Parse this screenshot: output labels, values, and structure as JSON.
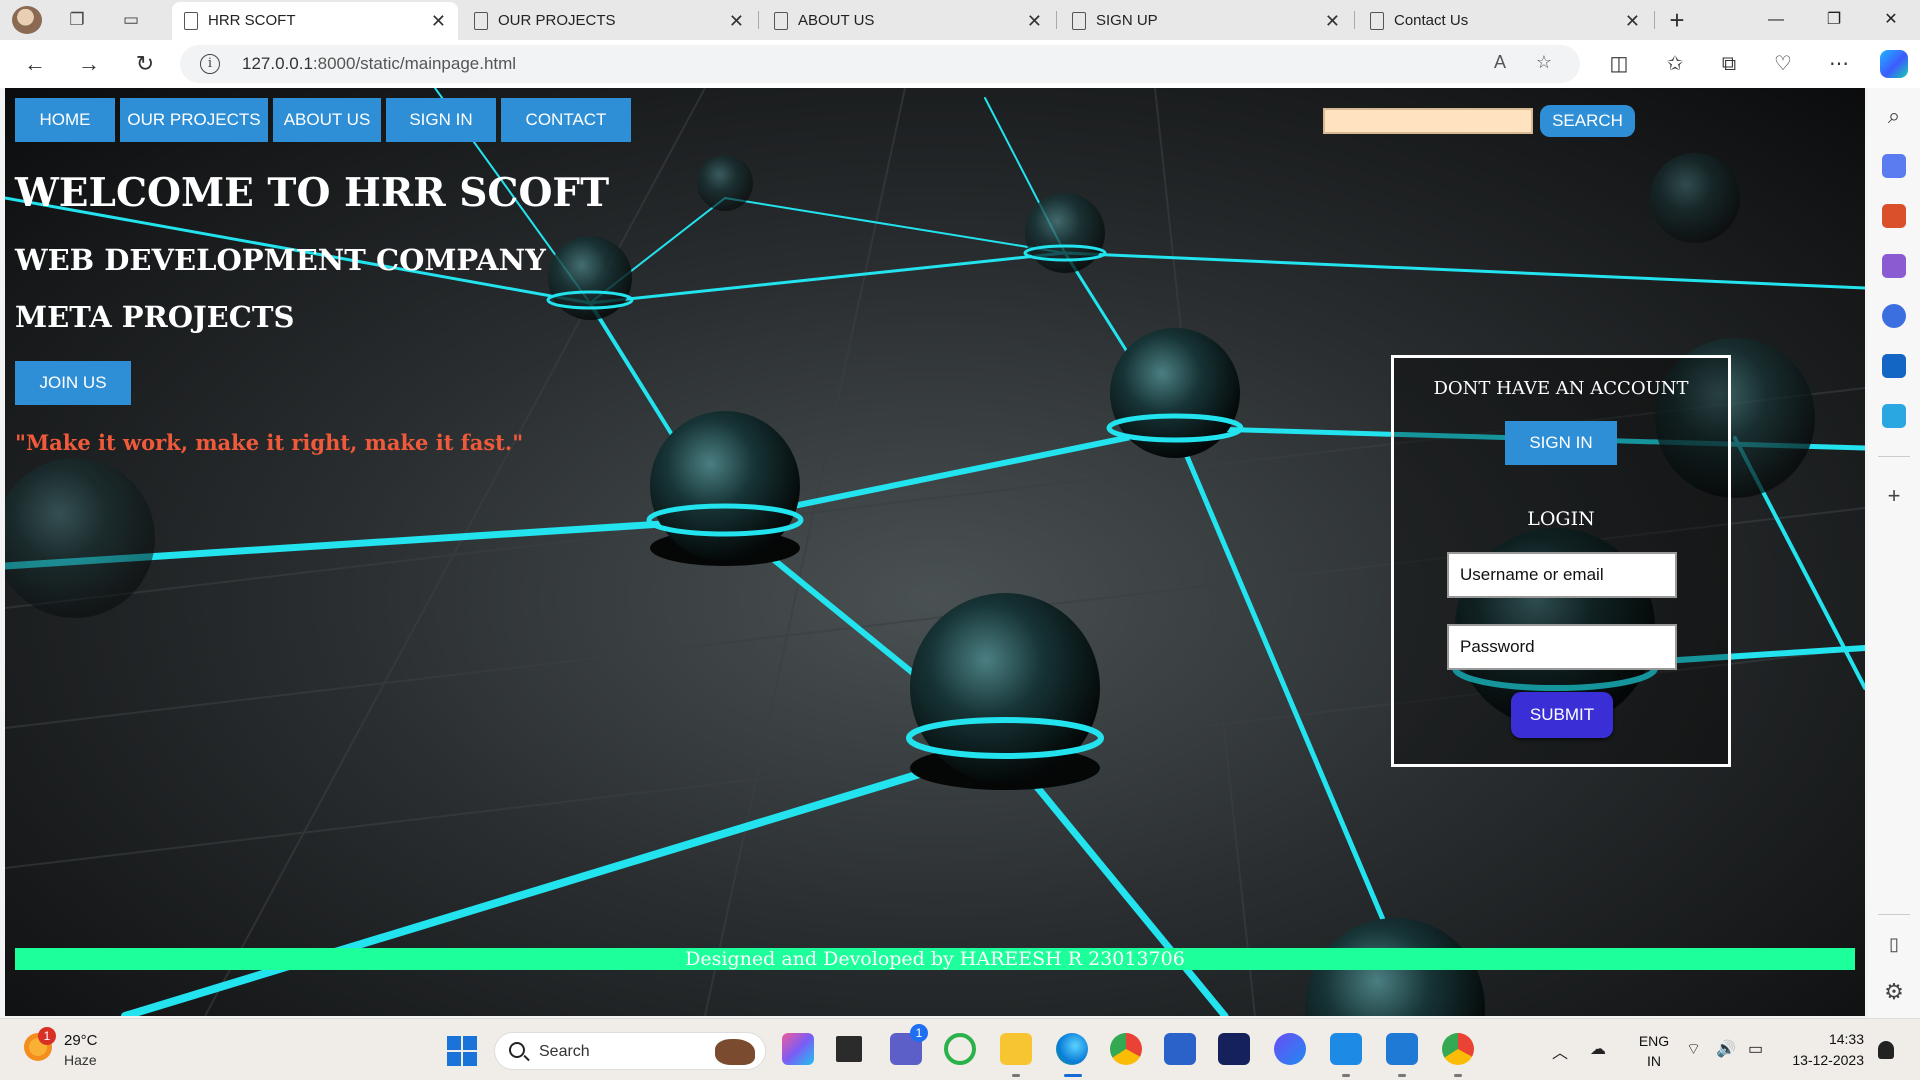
{
  "browser": {
    "tabs": [
      {
        "title": "HRR SCOFT",
        "active": true
      },
      {
        "title": "OUR PROJECTS",
        "active": false
      },
      {
        "title": "ABOUT US",
        "active": false
      },
      {
        "title": "SIGN UP",
        "active": false
      },
      {
        "title": "Contact Us",
        "active": false
      }
    ],
    "url_host": "127.0.0.1",
    "url_path": ":8000/static/mainpage.html",
    "icons": [
      "back-icon",
      "forward-icon",
      "refresh-icon",
      "info-icon",
      "read-aloud-icon",
      "favorite-star-icon",
      "split-screen-icon",
      "favorites-icon",
      "collections-icon",
      "browser-essentials-icon",
      "more-icon",
      "copilot-icon"
    ]
  },
  "page": {
    "nav": [
      "HOME",
      "OUR PROJECTS",
      "ABOUT US",
      "SIGN IN",
      "CONTACT"
    ],
    "search_value": "",
    "search_button": "SEARCH",
    "title": "WELCOME TO HRR SCOFT",
    "subtitle": "WEB DEVELOPMENT COMPANY",
    "subtitle2": "META PROJECTS",
    "join_button": "JOIN US",
    "quote": "\"Make it work, make it right, make it fast.\"",
    "panel": {
      "no_account": "DONT HAVE AN ACCOUNT",
      "signin_button": "SIGN IN",
      "login_heading": "LOGIN",
      "username_placeholder": "Username or email",
      "password_placeholder": "Password",
      "submit_button": "SUBMIT"
    },
    "footer": "Designed and Devoloped by HAREESH R 23013706",
    "colors": {
      "accent_blue": "#2f8fd6",
      "submit_blue": "#3a2fd6",
      "quote_red": "#f05a3a",
      "footer_green": "#1dff9a",
      "network_cyan": "#22e3ee"
    }
  },
  "taskbar": {
    "weather_badge": "1",
    "temperature": "29°C",
    "condition": "Haze",
    "search_label": "Search",
    "teams_badge": "1",
    "language": "ENG",
    "region": "IN",
    "time": "14:33",
    "date": "13-12-2023"
  }
}
